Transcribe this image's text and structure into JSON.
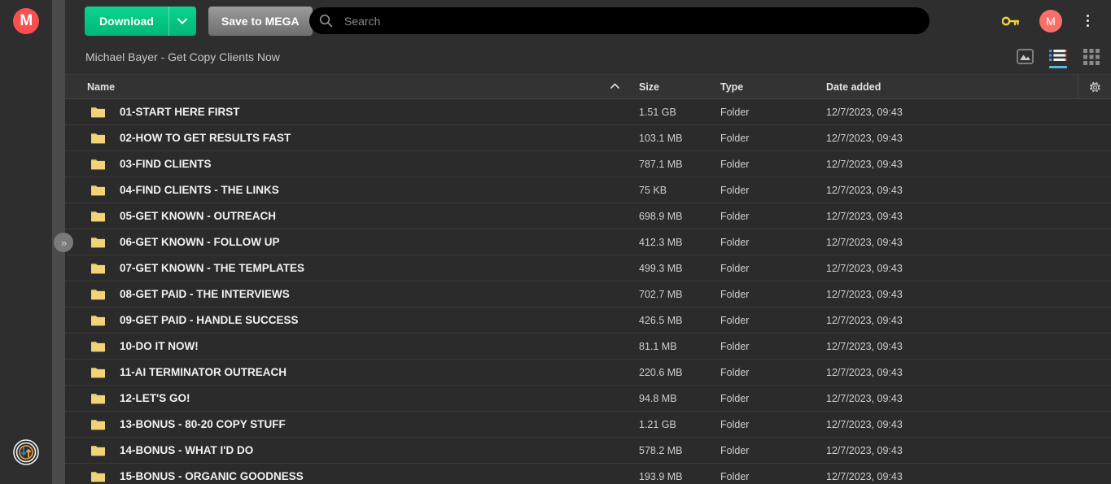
{
  "app": {
    "logo_letter": "M",
    "transfer_icon": "transfer-arrows-icon"
  },
  "sidebar": {
    "expand_label": "»"
  },
  "toolbar": {
    "download_label": "Download",
    "download_caret_icon": "chevron-down-icon",
    "save_label": "Save to MEGA",
    "key_icon": "key-icon",
    "avatar_letter": "M",
    "overflow_icon": "vertical-dots-icon"
  },
  "search": {
    "placeholder": "Search",
    "value": "",
    "icon": "search-icon"
  },
  "breadcrumb": {
    "path": "Michael Bayer - Get Copy Clients Now"
  },
  "view_modes": [
    {
      "name": "media-view",
      "icon": "image-mountain-icon",
      "active": false
    },
    {
      "name": "list-view",
      "icon": "list-icon",
      "active": true
    },
    {
      "name": "grid-view",
      "icon": "grid-icon",
      "active": false
    }
  ],
  "table": {
    "columns": {
      "name": "Name",
      "size": "Size",
      "type": "Type",
      "date": "Date added"
    },
    "sort": {
      "column": "name",
      "direction": "asc",
      "indicator": "▲"
    },
    "settings_icon": "gear-icon",
    "rows": [
      {
        "icon": "folder-icon",
        "name": "01-START HERE FIRST",
        "size": "1.51 GB",
        "type": "Folder",
        "date": "12/7/2023, 09:43"
      },
      {
        "icon": "folder-icon",
        "name": "02-HOW TO GET RESULTS FAST",
        "size": "103.1 MB",
        "type": "Folder",
        "date": "12/7/2023, 09:43"
      },
      {
        "icon": "folder-icon",
        "name": "03-FIND CLIENTS",
        "size": "787.1 MB",
        "type": "Folder",
        "date": "12/7/2023, 09:43"
      },
      {
        "icon": "folder-icon",
        "name": "04-FIND CLIENTS - THE LINKS",
        "size": "75 KB",
        "type": "Folder",
        "date": "12/7/2023, 09:43"
      },
      {
        "icon": "folder-icon",
        "name": "05-GET KNOWN - OUTREACH",
        "size": "698.9 MB",
        "type": "Folder",
        "date": "12/7/2023, 09:43"
      },
      {
        "icon": "folder-icon",
        "name": "06-GET KNOWN - FOLLOW UP",
        "size": "412.3 MB",
        "type": "Folder",
        "date": "12/7/2023, 09:43"
      },
      {
        "icon": "folder-icon",
        "name": "07-GET KNOWN - THE TEMPLATES",
        "size": "499.3 MB",
        "type": "Folder",
        "date": "12/7/2023, 09:43"
      },
      {
        "icon": "folder-icon",
        "name": "08-GET PAID - THE INTERVIEWS",
        "size": "702.7 MB",
        "type": "Folder",
        "date": "12/7/2023, 09:43"
      },
      {
        "icon": "folder-icon",
        "name": "09-GET PAID - HANDLE SUCCESS",
        "size": "426.5 MB",
        "type": "Folder",
        "date": "12/7/2023, 09:43"
      },
      {
        "icon": "folder-icon",
        "name": "10-DO IT NOW!",
        "size": "81.1 MB",
        "type": "Folder",
        "date": "12/7/2023, 09:43"
      },
      {
        "icon": "folder-icon",
        "name": "11-AI TERMINATOR OUTREACH",
        "size": "220.6 MB",
        "type": "Folder",
        "date": "12/7/2023, 09:43"
      },
      {
        "icon": "folder-icon",
        "name": "12-LET'S GO!",
        "size": "94.8 MB",
        "type": "Folder",
        "date": "12/7/2023, 09:43"
      },
      {
        "icon": "folder-icon",
        "name": "13-BONUS - 80-20 COPY STUFF",
        "size": "1.21 GB",
        "type": "Folder",
        "date": "12/7/2023, 09:43"
      },
      {
        "icon": "folder-icon",
        "name": "14-BONUS - WHAT I'D DO",
        "size": "578.2 MB",
        "type": "Folder",
        "date": "12/7/2023, 09:43"
      },
      {
        "icon": "folder-icon",
        "name": "15-BONUS - ORGANIC GOODNESS",
        "size": "193.9 MB",
        "type": "Folder",
        "date": "12/7/2023, 09:43"
      }
    ]
  },
  "colors": {
    "page_bg": "#2b2b2b",
    "panel_bg": "#2e2e2e",
    "accent_green": "#00b778",
    "accent_blue": "#52b9e9",
    "brand_red": "#f9504f",
    "folder_yellow": "#f3d37a",
    "key_yellow": "#f0d040"
  }
}
